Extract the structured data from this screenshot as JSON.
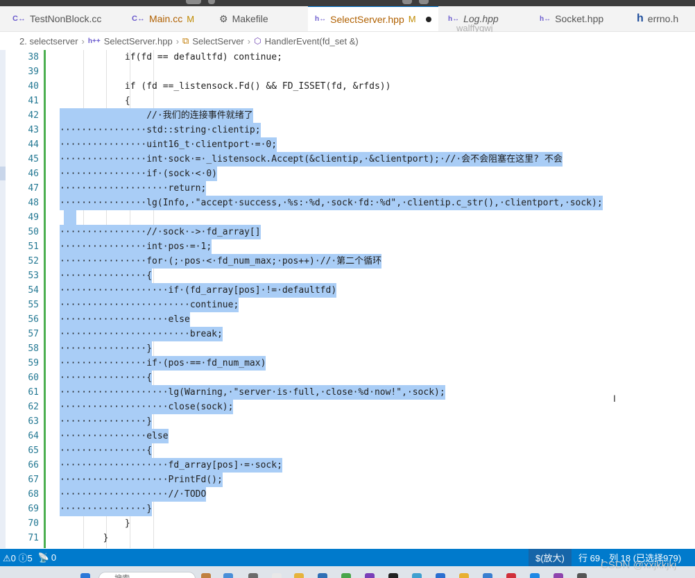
{
  "tabs": [
    {
      "label": "TestNonBlock.cc",
      "icon": "C++",
      "modified": ""
    },
    {
      "label": "Main.cc",
      "icon": "C++",
      "modified": "M"
    },
    {
      "label": "Makefile",
      "icon": "makefile",
      "modified": ""
    },
    {
      "label": "SelectServer.hpp",
      "icon": "h++",
      "modified": "M"
    },
    {
      "label": "Log.hpp",
      "icon": "h++",
      "modified": ""
    },
    {
      "label": "Socket.hpp",
      "icon": "h++",
      "modified": ""
    },
    {
      "label": "errno.h",
      "icon": "h",
      "modified": ""
    }
  ],
  "overlay_user": "walffyqwj",
  "breadcrumb": {
    "folder": "2. selectserver",
    "file_icon": "h++",
    "file": "SelectServer.hpp",
    "class": "SelectServer",
    "method": "HandlerEvent(fd_set &)"
  },
  "code_lines": [
    {
      "n": "38",
      "text": "            if(fd == defaultfd) continue;"
    },
    {
      "n": "39",
      "text": ""
    },
    {
      "n": "40",
      "text": "            if (fd ==_listensock.Fd() && FD_ISSET(fd, &rfds))"
    },
    {
      "n": "41",
      "text": "            {"
    },
    {
      "n": "42",
      "text": "                //·我们的连接事件就绪了"
    },
    {
      "n": "43",
      "text": "················std::string·clientip;"
    },
    {
      "n": "44",
      "text": "················uint16_t·clientport·=·0;"
    },
    {
      "n": "45",
      "text": "················int·sock·=·_listensock.Accept(&clientip,·&clientport);·//·会不会阻塞在这里? 不会"
    },
    {
      "n": "46",
      "text": "················if·(sock·<·0)"
    },
    {
      "n": "47",
      "text": "····················return;"
    },
    {
      "n": "48",
      "text": "················lg(Info,·\"accept·success,·%s:·%d,·sock·fd:·%d\",·clientip.c_str(),·clientport,·sock);"
    },
    {
      "n": "49",
      "text": ""
    },
    {
      "n": "50",
      "text": "················//·sock·->·fd_array[]"
    },
    {
      "n": "51",
      "text": "················int·pos·=·1;"
    },
    {
      "n": "52",
      "text": "················for·(;·pos·<·fd_num_max;·pos++)·//·第二个循环"
    },
    {
      "n": "53",
      "text": "················{"
    },
    {
      "n": "54",
      "text": "····················if·(fd_array[pos]·!=·defaultfd)"
    },
    {
      "n": "55",
      "text": "························continue;"
    },
    {
      "n": "56",
      "text": "····················else"
    },
    {
      "n": "57",
      "text": "························break;"
    },
    {
      "n": "58",
      "text": "················}"
    },
    {
      "n": "59",
      "text": "················if·(pos·==·fd_num_max)"
    },
    {
      "n": "60",
      "text": "················{"
    },
    {
      "n": "61",
      "text": "····················lg(Warning,·\"server·is·full,·close·%d·now!\",·sock);"
    },
    {
      "n": "62",
      "text": "····················close(sock);"
    },
    {
      "n": "63",
      "text": "················}"
    },
    {
      "n": "64",
      "text": "················else"
    },
    {
      "n": "65",
      "text": "················{"
    },
    {
      "n": "66",
      "text": "····················fd_array[pos]·=·sock;"
    },
    {
      "n": "67",
      "text": "····················PrintFd();"
    },
    {
      "n": "68",
      "text": "····················//·TODO"
    },
    {
      "n": "69",
      "text": "················}"
    },
    {
      "n": "70",
      "text": "            }"
    },
    {
      "n": "71",
      "text": "        }"
    }
  ],
  "statusbar": {
    "problems": "⚠0 ⓘ5",
    "ports": "0",
    "zoom": "$(放大)",
    "position": "行 69，列 18 (已选择979)"
  },
  "taskbar": {
    "search_placeholder": "搜索"
  },
  "watermark": "CSDN @xxjkkjkj",
  "colors": {
    "accent": "#007acc",
    "selection": "#a9cdf6",
    "gutter_modified": "#4caf50",
    "keyword": "#0000ff",
    "comment": "#008000",
    "string": "#a31515"
  }
}
